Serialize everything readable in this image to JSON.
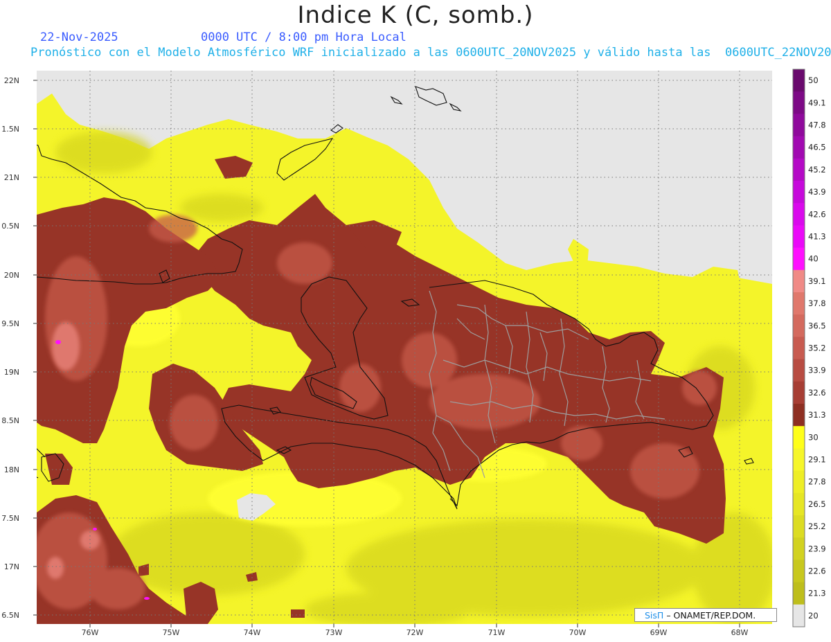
{
  "header": {
    "title": "Indice K (C, somb.)",
    "date": "22-Nov-2025",
    "time": "0000 UTC / 8:00 pm Hora Local",
    "forecast": "Pronóstico con el Modelo Atmosférico WRF inicializado a las 0600UTC_20NOV2025 y válido hasta las  0600UTC_22NOV2025"
  },
  "axes": {
    "lat_labels": [
      "22N",
      "1.5N",
      "21N",
      "0.5N",
      "20N",
      "9.5N",
      "19N",
      "8.5N",
      "18N",
      "7.5N",
      "17N",
      "6.5N"
    ],
    "lon_labels": [
      "76W",
      "75W",
      "74W",
      "73W",
      "72W",
      "71W",
      "70W",
      "69W",
      "68W"
    ]
  },
  "colorbar": {
    "labels": [
      "50",
      "49.1",
      "47.8",
      "46.5",
      "45.2",
      "43.9",
      "42.6",
      "41.3",
      "40",
      "39.1",
      "37.8",
      "36.5",
      "35.2",
      "33.9",
      "32.6",
      "31.3",
      "30",
      "29.1",
      "27.8",
      "26.5",
      "25.2",
      "23.9",
      "22.6",
      "21.3",
      "20"
    ],
    "colors": [
      "#6a0a6e",
      "#7d0a86",
      "#8f0a9c",
      "#a10ab1",
      "#b40ac6",
      "#c60adb",
      "#d90aec",
      "#ea0af8",
      "#ff10ff",
      "#f08a86",
      "#e0786c",
      "#d46a5e",
      "#c85b50",
      "#b84c42",
      "#a73e34",
      "#8e2f22",
      "#ffff1a",
      "#f6f62a",
      "#eeee26",
      "#e6e624",
      "#dcdc22",
      "#d2d220",
      "#c8c81e",
      "#bebe1c",
      "#e6e6e6"
    ]
  },
  "credit": {
    "brand": "SisΠ",
    "org": "– ONAMET/REP.DOM."
  }
}
